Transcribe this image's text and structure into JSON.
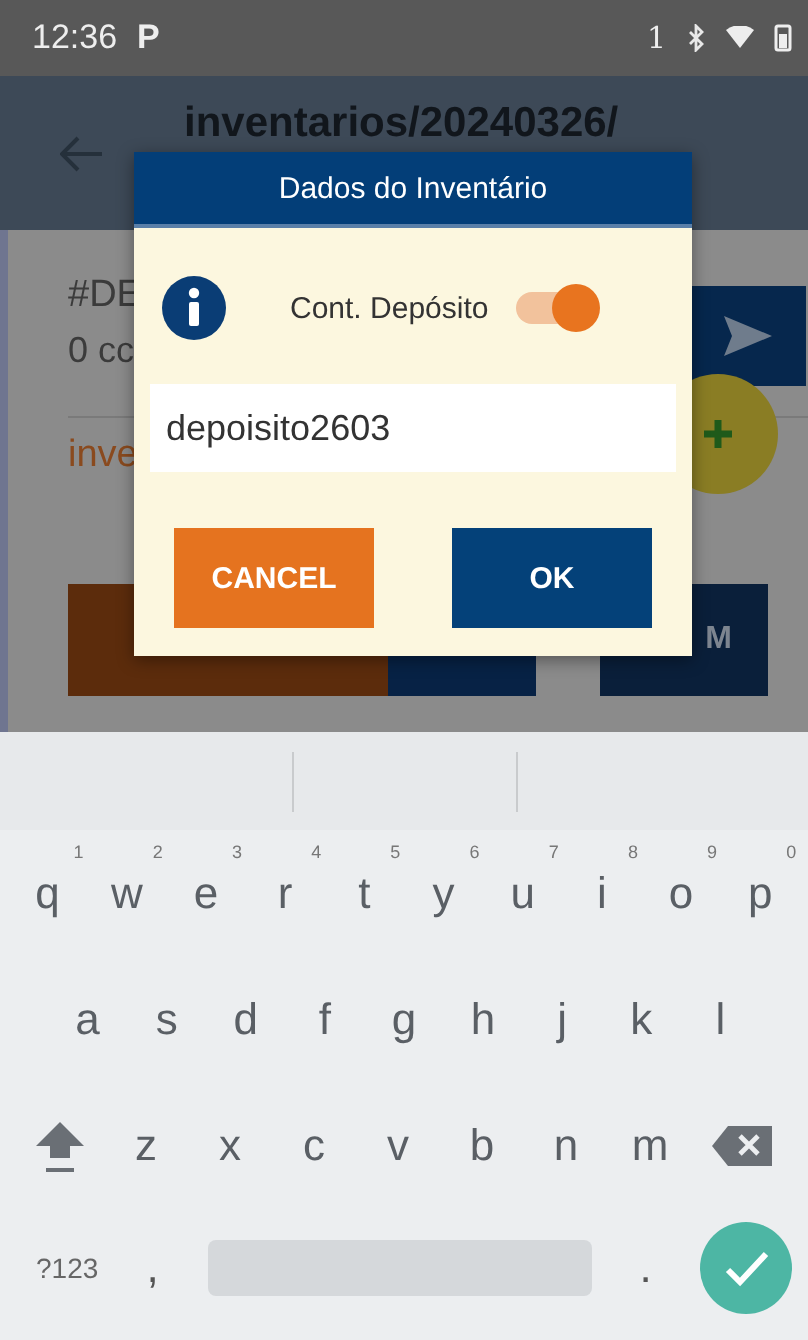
{
  "status_bar": {
    "time": "12:36",
    "notification": "P",
    "sim": "1"
  },
  "app_bar": {
    "title": "inventarios/20240326/"
  },
  "list": [
    {
      "title": "#DE",
      "subtitle": "0 cc",
      "kind": "plain"
    },
    {
      "title": "inve",
      "kind": "accent"
    }
  ],
  "action_buttons": [
    {
      "color": "#5c2c0c"
    },
    {
      "color": "#072245"
    },
    {
      "color": "#0a1f3a",
      "label": "M"
    }
  ],
  "dialog": {
    "title": "Dados do Inventário",
    "toggle": {
      "label": "Cont. Depósito",
      "on": true
    },
    "field": {
      "value": "depoisito2603"
    },
    "buttons": [
      {
        "label": "CANCEL",
        "kind": "cancel"
      },
      {
        "label": "OK",
        "kind": "ok"
      }
    ]
  },
  "keyboard": {
    "rows": [
      [
        {
          "key": "q",
          "hint": "1"
        },
        {
          "key": "w",
          "hint": "2"
        },
        {
          "key": "e",
          "hint": "3"
        },
        {
          "key": "r",
          "hint": "4"
        },
        {
          "key": "t",
          "hint": "5"
        },
        {
          "key": "y",
          "hint": "6"
        },
        {
          "key": "u",
          "hint": "7"
        },
        {
          "key": "i",
          "hint": "8"
        },
        {
          "key": "o",
          "hint": "9"
        },
        {
          "key": "p",
          "hint": "0"
        }
      ],
      [
        {
          "key": "a"
        },
        {
          "key": "s"
        },
        {
          "key": "d"
        },
        {
          "key": "f"
        },
        {
          "key": "g"
        },
        {
          "key": "h"
        },
        {
          "key": "j"
        },
        {
          "key": "k"
        },
        {
          "key": "l"
        }
      ],
      [
        {
          "kind": "shift"
        },
        {
          "key": "z"
        },
        {
          "key": "x"
        },
        {
          "key": "c"
        },
        {
          "key": "v"
        },
        {
          "key": "b"
        },
        {
          "key": "n"
        },
        {
          "key": "m"
        },
        {
          "kind": "backspace"
        }
      ]
    ],
    "bottom_bar": {
      "symbols_key": "?123",
      "comma_key": ",",
      "period_key": "."
    }
  }
}
